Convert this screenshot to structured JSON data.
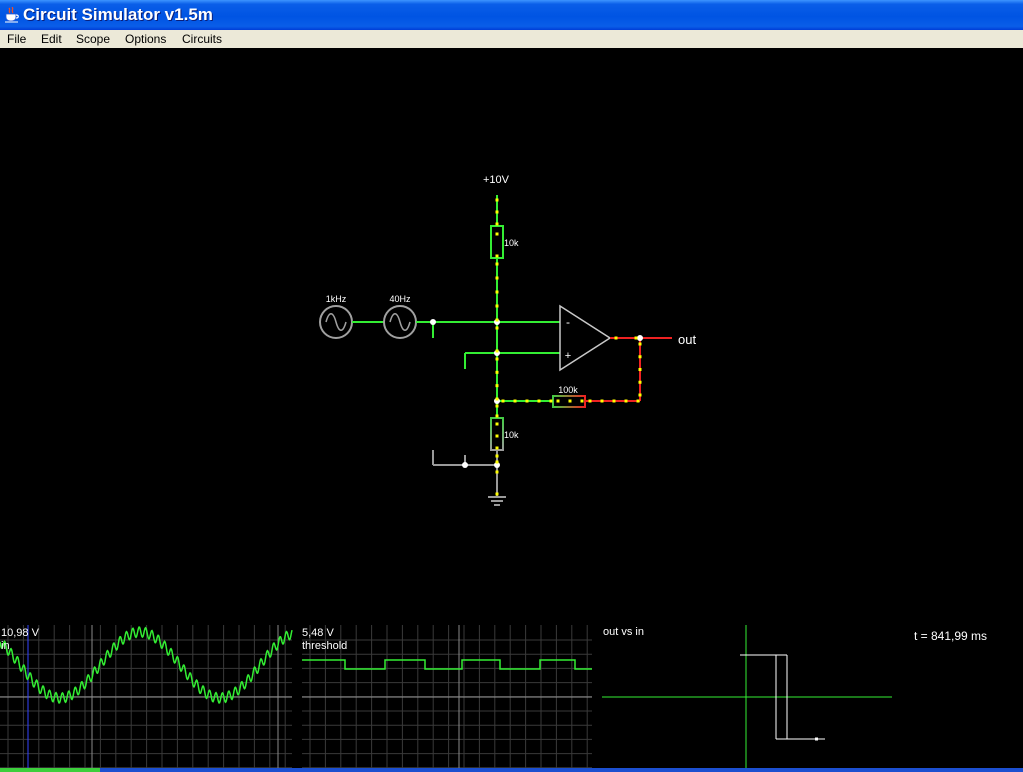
{
  "window": {
    "title": "Circuit Simulator v1.5m",
    "icon": "java-cup-icon"
  },
  "menu": {
    "items": [
      "File",
      "Edit",
      "Scope",
      "Options",
      "Circuits"
    ]
  },
  "circuit": {
    "supply_label": "+10V",
    "r1_label": "10k",
    "source1_label": "1kHz",
    "source2_label": "40Hz",
    "feedback_label": "100k",
    "r2_label": "10k",
    "output_label": "out",
    "opamp_minus": "-",
    "opamp_plus": "+"
  },
  "scopes": {
    "in": {
      "value": "10,98 V",
      "name": "in"
    },
    "threshold": {
      "value": "5,48 V",
      "name": "threshold"
    },
    "xy": {
      "name": "out vs in"
    }
  },
  "time": "t = 841,99 ms",
  "colors": {
    "titlebar": "#0054e3",
    "menubar": "#ece9d8",
    "canvas": "#000000",
    "wire_positive": "#33ee33",
    "wire_negative": "#ee2222",
    "wire_ground": "#9a9a9a",
    "current_dot": "#ffff00",
    "scope_trace": "#33ee33",
    "xy_trace": "#ffffff"
  }
}
